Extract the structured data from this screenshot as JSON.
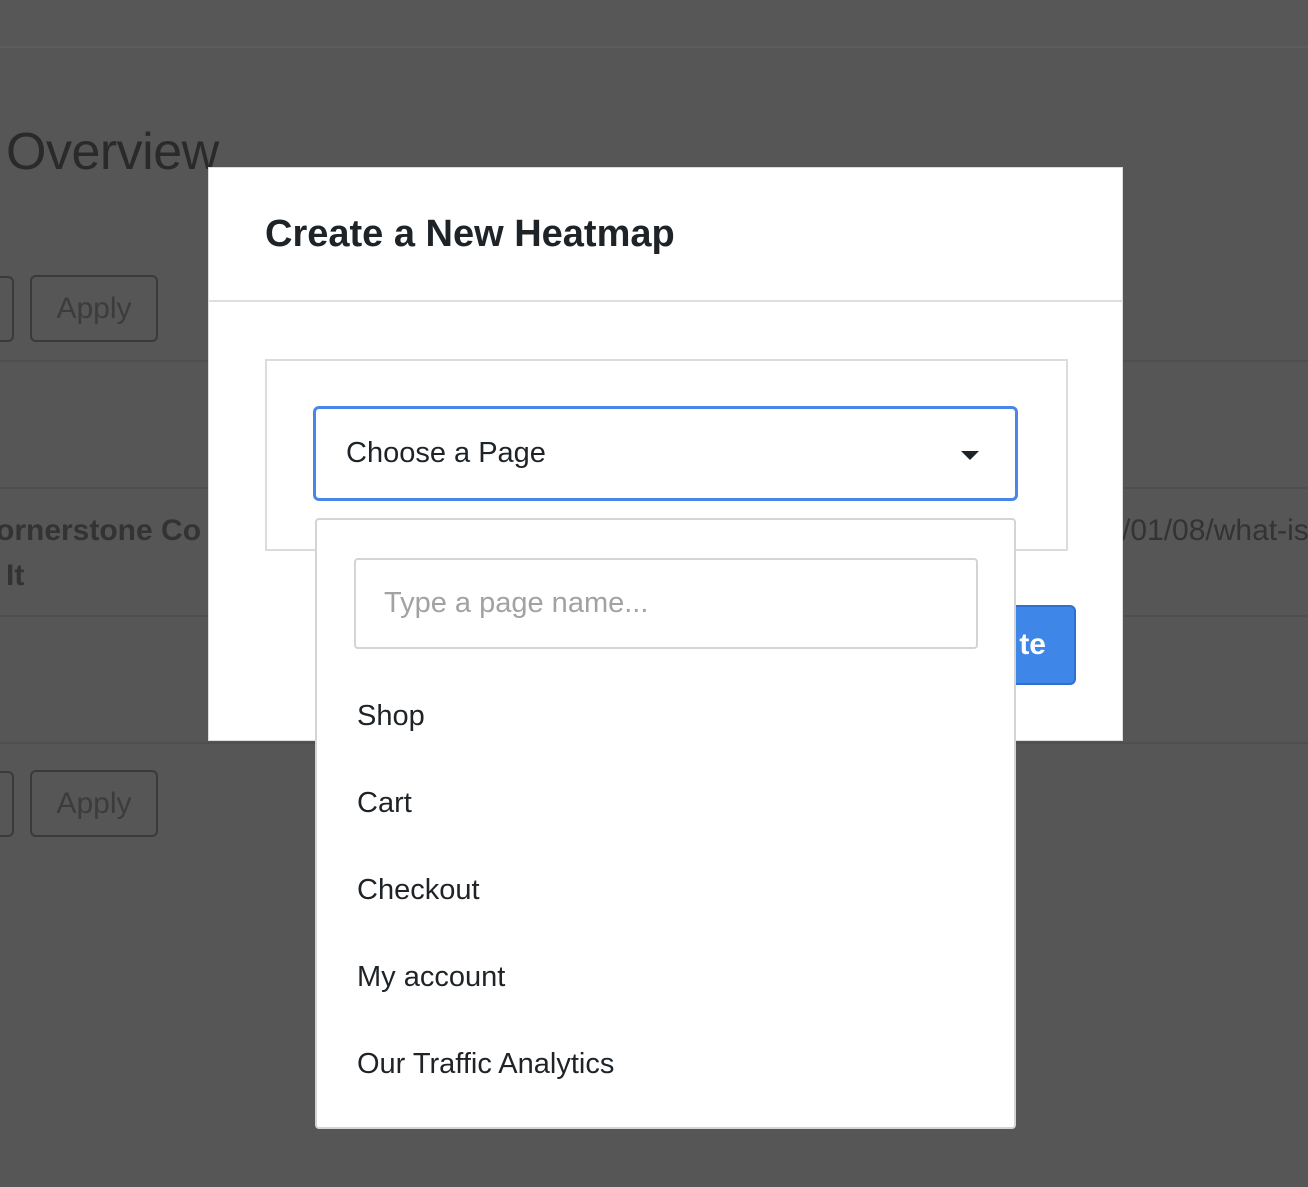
{
  "background": {
    "page_title": "Overview",
    "apply_top": "Apply",
    "apply_bottom": "Apply",
    "row_text_line1": "ornerstone Co",
    "row_text_line2": "It",
    "row_url": "/01/08/what-is"
  },
  "modal": {
    "title": "Create a New Heatmap",
    "select_value": "Choose a Page",
    "create_button_partial": "te",
    "accent_color": "#4a86e8"
  },
  "dropdown": {
    "search_placeholder": "Type a page name...",
    "options": [
      "Shop",
      "Cart",
      "Checkout",
      "My account",
      "Our Traffic Analytics"
    ]
  }
}
